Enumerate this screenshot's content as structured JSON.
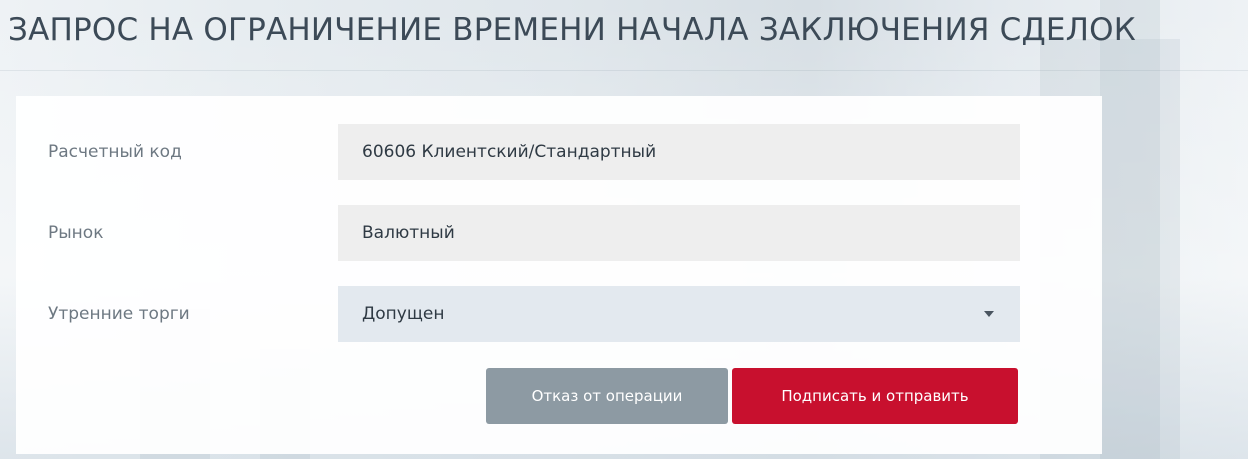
{
  "page": {
    "title": "ЗАПРОС НА ОГРАНИЧЕНИЕ ВРЕМЕНИ НАЧАЛА ЗАКЛЮЧЕНИЯ СДЕЛОК"
  },
  "form": {
    "fields": [
      {
        "label": "Расчетный код",
        "value": "60606 Клиентский/Стандартный"
      },
      {
        "label": "Рынок",
        "value": "Валютный"
      },
      {
        "label": "Утренние торги",
        "value": "Допущен"
      }
    ]
  },
  "actions": {
    "cancel_label": "Отказ от операции",
    "submit_label": "Подписать и отправить"
  },
  "colors": {
    "accent": "#c8102e",
    "secondary_button": "#8d9aa3",
    "title_text": "#3c4a57"
  },
  "icons": {
    "select_caret": "caret-down-icon"
  }
}
